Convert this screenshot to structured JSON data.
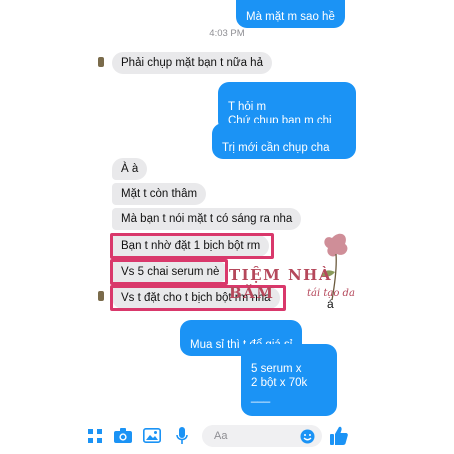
{
  "thread": {
    "top_partial_message": "Mà mặt m sao hề",
    "timestamp": "4:03 PM",
    "messages_in_1": [
      "Phải chụp mặt bạn t nữa hả"
    ],
    "messages_out_1": [
      "T hỏi m\nChứ chụp bạn m chi",
      "Trị mới cần chụp cha"
    ],
    "messages_in_2": [
      "À à",
      "Mặt t còn thâm",
      "Mà bạn t nói mặt t có sáng ra nha",
      "Bạn t nhờ đặt 1 bịch bột rm",
      "Vs 5 chai serum nè",
      "Vs t đặt cho t bịch bột rm nha"
    ],
    "messages_out_2": [
      "Mua sỉ thì t để giá sỉ",
      "5 serum x\n2 bột x 70k\n___"
    ],
    "partial_accent": "á"
  },
  "watermark": {
    "brand": "TIỆM NHÀ BĂM",
    "tagline": "tái tạo da"
  },
  "composer": {
    "placeholder": "Aa"
  },
  "colors": {
    "outgoing": "#1b93f5",
    "incoming": "#e9e9eb",
    "highlight": "#d9386b"
  }
}
